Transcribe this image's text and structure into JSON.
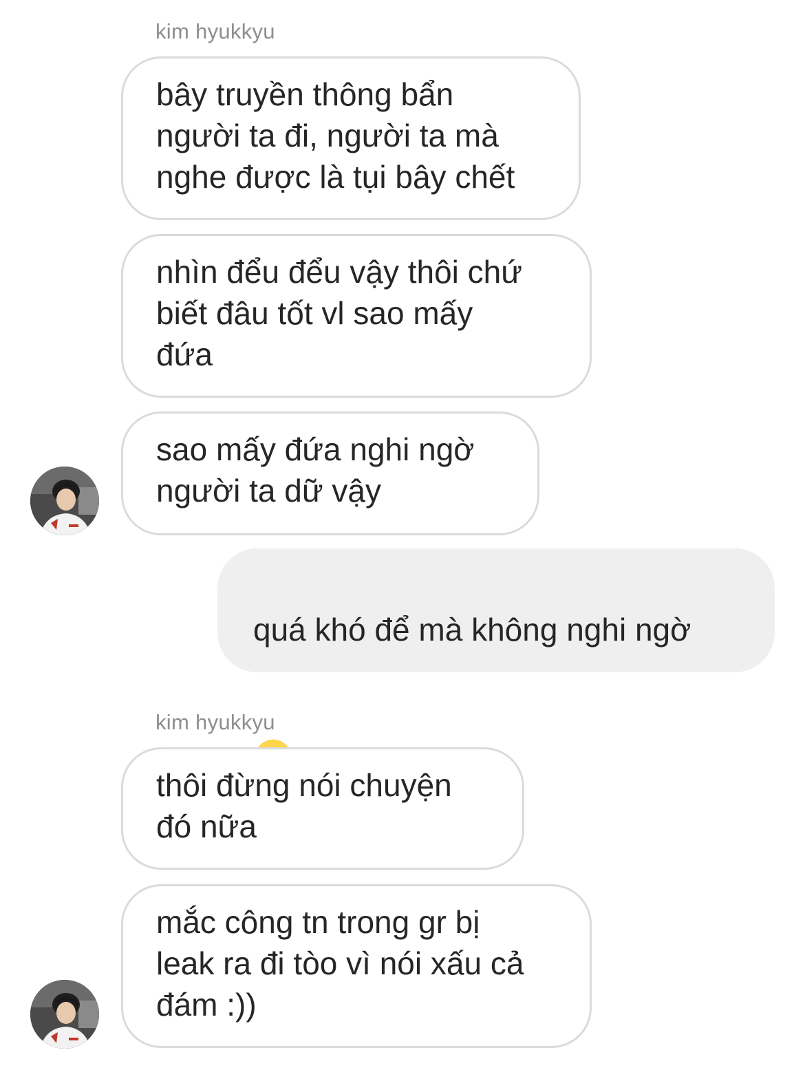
{
  "conversation": {
    "sender_name": "kim hyukkyu",
    "messages": [
      {
        "direction": "incoming",
        "text": "bây truyền thông bẩn\nngười ta đi, người ta mà\nnghe được là tụi bây chết"
      },
      {
        "direction": "incoming",
        "text": "nhìn đểu đểu vậy thôi chứ\nbiết đâu tốt vl sao mấy\nđứa"
      },
      {
        "direction": "incoming",
        "text": "sao mấy đứa nghi ngờ\nngười ta dữ vậy"
      },
      {
        "direction": "outgoing",
        "text": "quá khó để mà không nghi ngờ",
        "emoji": "smiling-face-with-tear-emoji"
      },
      {
        "direction": "incoming",
        "text": "thôi đừng nói chuyện\nđó nữa"
      },
      {
        "direction": "incoming",
        "text": "mắc công tn trong gr bị\nleak ra đi tòo vì nói xấu cả\nđám :))"
      }
    ]
  },
  "colors": {
    "incoming_border": "#dbdbdb",
    "outgoing_bg": "#efefef",
    "sender_name": "#8e8e8e",
    "text": "#262626"
  }
}
